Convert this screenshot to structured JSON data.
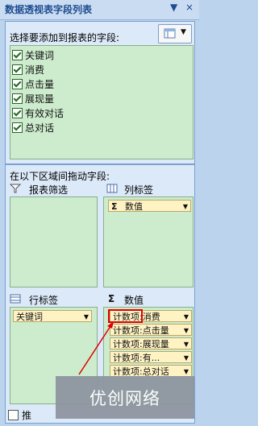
{
  "title": "数据透视表字段列表",
  "title_controls": {
    "dropdown": "▼",
    "close": "×"
  },
  "choose_label": "选择要添加到报表的字段:",
  "fields": [
    "关键词",
    "消费",
    "点击量",
    "展现量",
    "有效对话",
    "总对话"
  ],
  "drag_label": "在以下区域间拖动字段:",
  "report_filter_label": "报表筛选",
  "column_label_title": "列标签",
  "column_label_item": "数值",
  "row_label_title": "行标签",
  "row_label_item": "关键词",
  "values_title": "数值",
  "values_items": [
    "计数项:消费",
    "计数项:点击量",
    "计数项:展现量",
    "计数项:有...",
    "计数项:总对话"
  ],
  "defer_label": "推",
  "watermark": "优创网络",
  "sigma": "Σ",
  "colors": {
    "highlight": "#e00000",
    "pill": "#fff3c4",
    "area": "#cdeccd"
  }
}
